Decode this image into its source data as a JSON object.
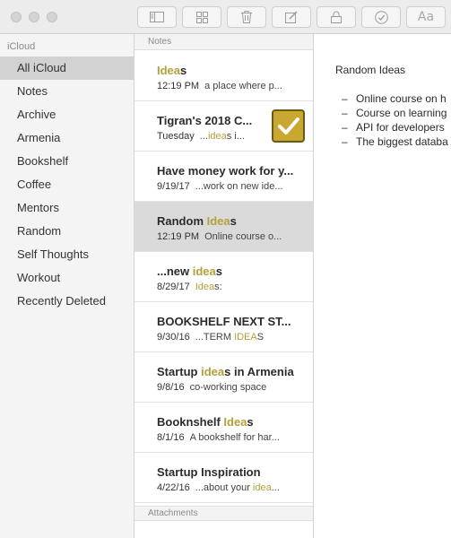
{
  "toolbar": {
    "buttons": [
      "sidebar-toggle",
      "attachments-grid",
      "trash",
      "compose",
      "lock",
      "checklist",
      "format"
    ],
    "format_label": "Aa"
  },
  "sidebar": {
    "header": "iCloud",
    "folders": [
      "All iCloud",
      "Notes",
      "Archive",
      "Armenia",
      "Bookshelf",
      "Coffee",
      "Mentors",
      "Random",
      "Self Thoughts",
      "Workout",
      "Recently Deleted"
    ],
    "selected": "All iCloud"
  },
  "notes_list": {
    "header": "Notes",
    "attachments_header": "Attachments",
    "highlight_color": "#b3a038",
    "notes": [
      {
        "title": "Ideas",
        "date": "12:19 PM",
        "preview": "a place where p..."
      },
      {
        "title": "Tigran's 2018 C...",
        "date": "Tuesday",
        "preview": "...ideas i..."
      },
      {
        "title": "Have money work for y...",
        "date": "9/19/17",
        "preview": "...work on new ide..."
      },
      {
        "title": "Random Ideas",
        "date": "12:19 PM",
        "preview": "Online course o..."
      },
      {
        "title": "...new ideas",
        "date": "8/29/17",
        "preview": "Ideas:"
      },
      {
        "title": "BOOKSHELF NEXT ST...",
        "date": "9/30/16",
        "preview": "...TERM IDEAS"
      },
      {
        "title": "Startup ideas in Armenia",
        "date": "9/8/16",
        "preview": "co-working space"
      },
      {
        "title": "Booknshelf Ideas",
        "date": "8/1/16",
        "preview": "A bookshelf for har..."
      },
      {
        "title": "Startup Inspiration",
        "date": "4/22/16",
        "preview": "...about your idea..."
      }
    ]
  },
  "detail": {
    "title": "Random Ideas",
    "bullets": [
      "Online course on h",
      "Course on learning",
      "API for developers",
      "The biggest databa"
    ]
  }
}
